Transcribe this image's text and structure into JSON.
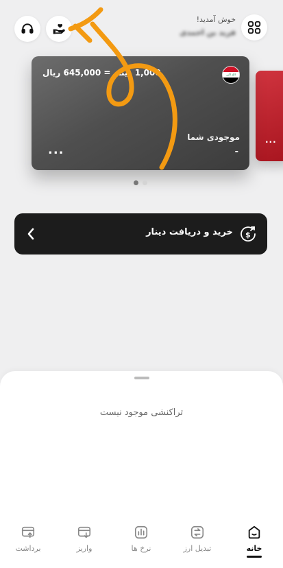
{
  "header": {
    "welcome": "خوش آمدید!",
    "user_name": "فرید بن احمدی"
  },
  "card": {
    "rate": "1,000 دینار = 645,000 ریال",
    "flag_text": "الله اکبر",
    "balance_label": "موجودی شما",
    "balance_value": "-",
    "more": "...",
    "second_card_more": "..."
  },
  "pager": {
    "count": 2,
    "active_index": 0
  },
  "buy_bar": {
    "label": "خرید و دریافت دینار"
  },
  "transactions": {
    "empty_text": "تراکنشی موجود نیست"
  },
  "nav": {
    "items": [
      {
        "label": "خانه",
        "icon": "home-icon",
        "active": true
      },
      {
        "label": "تبدیل ارز",
        "icon": "exchange-icon",
        "active": false
      },
      {
        "label": "نرخ ها",
        "icon": "rates-icon",
        "active": false
      },
      {
        "label": "واریز",
        "icon": "deposit-icon",
        "active": false
      },
      {
        "label": "برداشت",
        "icon": "withdraw-icon",
        "active": false
      }
    ]
  },
  "colors": {
    "background": "#efeff0",
    "card_dark": "#4f4f4f",
    "card_red": "#c0242f",
    "buy_bar": "#1c1c1c",
    "annotation_arrow": "#f39a12"
  }
}
